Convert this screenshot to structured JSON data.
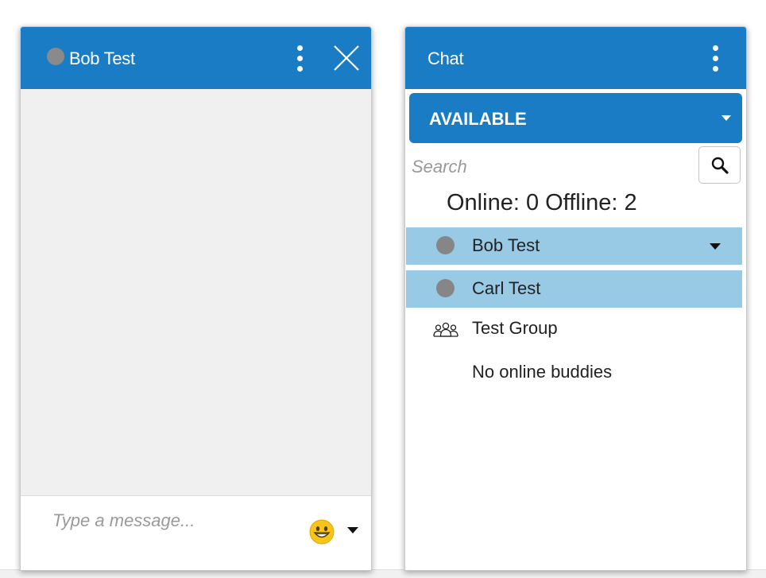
{
  "chat_window": {
    "title": "Bob Test",
    "status_dot_color": "#8a8a8a",
    "menu_icon": "kebab-vertical-icon",
    "close_icon": "close-icon",
    "message_placeholder": "Type a message...",
    "emoji_icon": "grinning-face-emoji-icon",
    "emoji_menu_icon": "caret-down-icon"
  },
  "buddy_panel": {
    "title": "Chat",
    "menu_icon": "kebab-vertical-icon",
    "status_selector": {
      "value": "AVAILABLE",
      "icon": "caret-down-icon"
    },
    "search": {
      "placeholder": "Search",
      "icon": "magnifier-icon"
    },
    "counts_text": "Online: 0 Offline: 2",
    "buddies": [
      {
        "name": "Bob Test",
        "status": "offline",
        "selected": true,
        "has_menu": true
      },
      {
        "name": "Carl Test",
        "status": "offline",
        "selected": true,
        "has_menu": false
      }
    ],
    "group": {
      "name": "Test Group",
      "icon": "group-people-icon"
    },
    "empty_message": "No online buddies"
  },
  "colors": {
    "header_blue": "#1a7cc4",
    "selected_row": "#98cae6",
    "offline_dot": "#868686",
    "chat_area": "#f0f0f0"
  }
}
